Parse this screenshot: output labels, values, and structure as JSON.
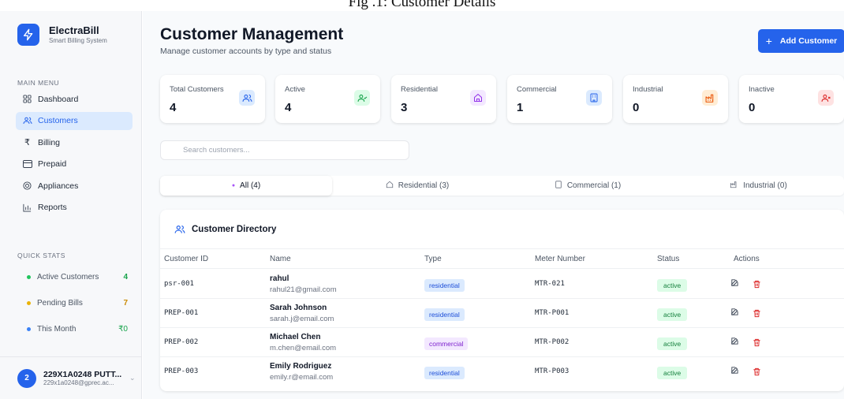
{
  "caption": "Fig .1: Customer Details",
  "brand": {
    "name": "ElectraBill",
    "subtitle": "Smart Billing System"
  },
  "sidebar": {
    "main_menu_title": "MAIN MENU",
    "items": [
      {
        "label": "Dashboard",
        "icon": "dashboard-icon"
      },
      {
        "label": "Customers",
        "icon": "users-icon",
        "active": true
      },
      {
        "label": "Billing",
        "icon": "rupee-icon"
      },
      {
        "label": "Prepaid",
        "icon": "card-icon"
      },
      {
        "label": "Appliances",
        "icon": "appliance-icon"
      },
      {
        "label": "Reports",
        "icon": "chart-icon"
      }
    ],
    "quick_stats_title": "QUICK STATS",
    "quick_stats": [
      {
        "label": "Active Customers",
        "value": "4",
        "color": "#22c55e"
      },
      {
        "label": "Pending Bills",
        "value": "7",
        "color": "#eab308"
      },
      {
        "label": "This Month",
        "value": "₹0",
        "color": "#3b82f6"
      }
    ],
    "user": {
      "initial": "2",
      "name": "229X1A0248 PUTT...",
      "email": "229x1a0248@gprec.ac..."
    }
  },
  "header": {
    "title": "Customer Management",
    "subtitle": "Manage customer accounts by type and status",
    "add_button": "Add Customer"
  },
  "stats": [
    {
      "label": "Total Customers",
      "value": "4",
      "icon": "users-icon",
      "color": "#2563eb",
      "bg": "#dbeafe"
    },
    {
      "label": "Active",
      "value": "4",
      "icon": "user-check-icon",
      "color": "#16a34a",
      "bg": "#dcfce7"
    },
    {
      "label": "Residential",
      "value": "3",
      "icon": "home-icon",
      "color": "#9333ea",
      "bg": "#f3e8ff"
    },
    {
      "label": "Commercial",
      "value": "1",
      "icon": "building-icon",
      "color": "#2563eb",
      "bg": "#dbeafe"
    },
    {
      "label": "Industrial",
      "value": "0",
      "icon": "factory-icon",
      "color": "#ea580c",
      "bg": "#ffedd5"
    },
    {
      "label": "Inactive",
      "value": "0",
      "icon": "user-x-icon",
      "color": "#dc2626",
      "bg": "#fee2e2"
    }
  ],
  "search": {
    "placeholder": "Search customers..."
  },
  "tabs": [
    {
      "label": "All (4)",
      "active": true
    },
    {
      "label": "Residential (3)"
    },
    {
      "label": "Commercial (1)"
    },
    {
      "label": "Industrial (0)"
    }
  ],
  "directory": {
    "title": "Customer Directory",
    "columns": [
      "Customer ID",
      "Name",
      "Type",
      "Meter Number",
      "Status",
      "Actions"
    ],
    "rows": [
      {
        "id": "psr-001",
        "name": "rahul",
        "email": "rahul21@gmail.com",
        "type": "residential",
        "meter": "MTR-021",
        "status": "active"
      },
      {
        "id": "PREP-001",
        "name": "Sarah Johnson",
        "email": "sarah.j@email.com",
        "type": "residential",
        "meter": "MTR-P001",
        "status": "active"
      },
      {
        "id": "PREP-002",
        "name": "Michael Chen",
        "email": "m.chen@email.com",
        "type": "commercial",
        "meter": "MTR-P002",
        "status": "active"
      },
      {
        "id": "PREP-003",
        "name": "Emily Rodriguez",
        "email": "emily.r@email.com",
        "type": "residential",
        "meter": "MTR-P003",
        "status": "active"
      }
    ]
  }
}
